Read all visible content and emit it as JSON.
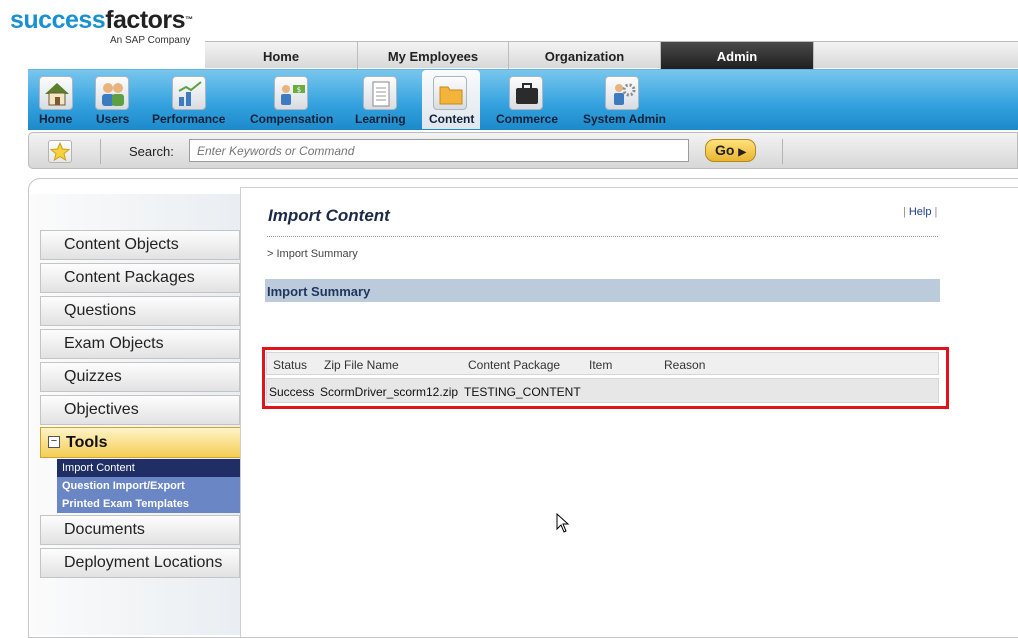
{
  "logo": {
    "brand_part1": "success",
    "brand_part2": "factors",
    "tm": "™",
    "tagline": "An SAP Company"
  },
  "top_tabs": [
    {
      "label": "Home"
    },
    {
      "label": "My Employees"
    },
    {
      "label": "Organization"
    },
    {
      "label": "Admin",
      "active": true
    }
  ],
  "modules": [
    {
      "label": "Home",
      "icon": "house-icon"
    },
    {
      "label": "Users",
      "icon": "users-icon"
    },
    {
      "label": "Performance",
      "icon": "performance-chart-icon"
    },
    {
      "label": "Compensation",
      "icon": "compensation-icon"
    },
    {
      "label": "Learning",
      "icon": "document-icon"
    },
    {
      "label": "Content",
      "icon": "folder-icon",
      "active": true
    },
    {
      "label": "Commerce",
      "icon": "briefcase-icon"
    },
    {
      "label": "System Admin",
      "icon": "system-admin-gear-icon"
    }
  ],
  "search": {
    "label": "Search:",
    "placeholder": "Enter Keywords or Command",
    "go_label": "Go",
    "favorite_icon": "star-icon"
  },
  "sidebar": {
    "items_top": [
      {
        "label": "Content Objects"
      },
      {
        "label": "Content Packages"
      },
      {
        "label": "Questions"
      },
      {
        "label": "Exam Objects"
      },
      {
        "label": "Quizzes"
      },
      {
        "label": "Objectives"
      }
    ],
    "tools": {
      "label": "Tools",
      "toggle_symbol": "−",
      "subitems": [
        {
          "label": "Import Content",
          "active": true
        },
        {
          "label": "Question Import/Export"
        },
        {
          "label": "Printed Exam Templates"
        }
      ]
    },
    "items_bottom": [
      {
        "label": "Documents"
      },
      {
        "label": "Deployment Locations"
      }
    ]
  },
  "main": {
    "title": "Import Content",
    "help": "Help",
    "help_sep": "|",
    "breadcrumb": "> Import Summary",
    "section_title": "Import Summary",
    "table": {
      "columns": [
        "Status",
        "Zip File Name",
        "Content Package",
        "Item",
        "Reason"
      ],
      "rows": [
        [
          "Success",
          "ScormDriver_scorm12.zip",
          "TESTING_CONTENT",
          "",
          ""
        ]
      ]
    }
  },
  "colors": {
    "accent_blue": "#37a4e0",
    "highlight_red": "#e1141c",
    "tools_gold": "#f4cd54",
    "active_sub": "#1f2f66"
  }
}
